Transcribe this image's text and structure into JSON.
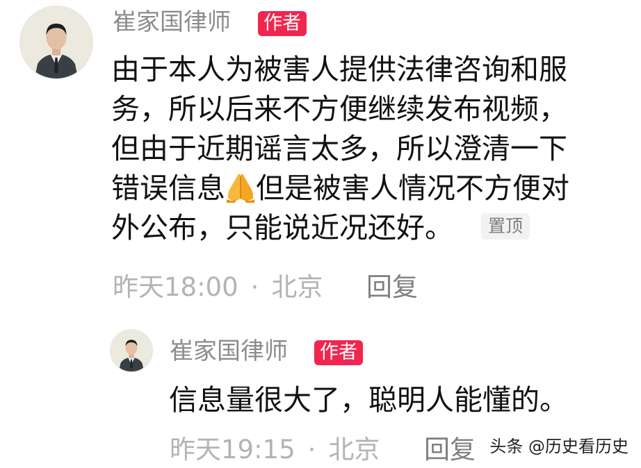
{
  "comment": {
    "author": "崔家国律师",
    "author_badge": "作者",
    "lines": [
      "由于本人为被害人提供法律咨询和服",
      "务，所以后来不方便继续发布视频，",
      "但由于近期谣言太多，所以澄清一下",
      "错误信息",
      "但是被害人情况不方便对",
      "外公布，只能说近况还好。"
    ],
    "emoji": "folded-hands-icon",
    "pinned_label": "置顶",
    "time": "昨天18:00",
    "separator": "·",
    "location": "北京",
    "reply_label": "回复"
  },
  "reply_comment": {
    "author": "崔家国律师",
    "author_badge": "作者",
    "text": "信息量很大了，聪明人能懂的。",
    "time": "昨天19:15",
    "separator": "·",
    "location": "北京",
    "reply_label": "回复"
  },
  "watermark": "头条 @历史看历史",
  "colors": {
    "badge": "#f0264e",
    "author_name": "#8c8c8c",
    "meta": "#b3b3b3",
    "body": "#111111"
  }
}
